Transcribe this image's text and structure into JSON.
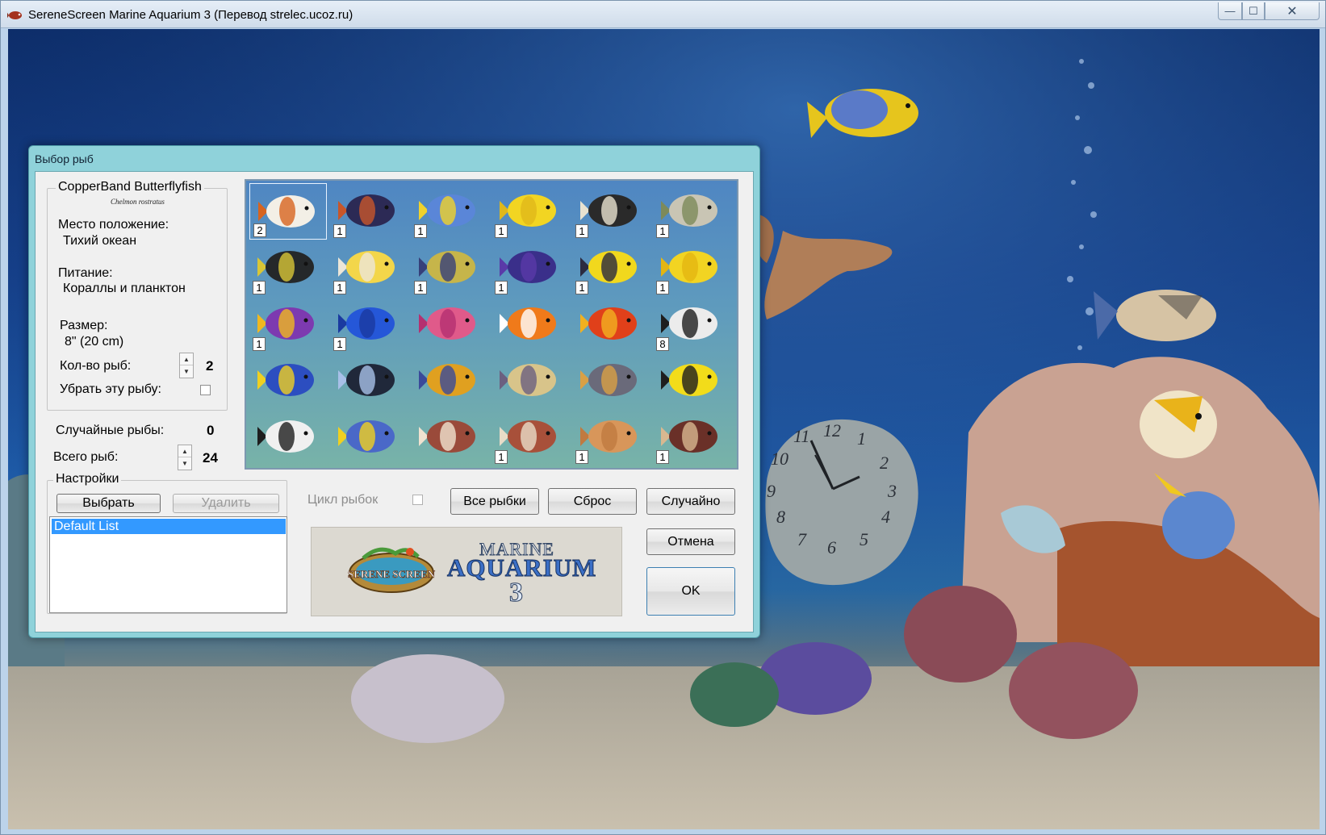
{
  "window": {
    "title": "SereneScreen Marine Aquarium 3 (Перевод strelec.ucoz.ru)",
    "controls": {
      "minimize": "—",
      "maximize": "☐",
      "close": "✕"
    }
  },
  "dialog": {
    "title": "Выбор рыб",
    "fish_info": {
      "name": "CopperBand Butterflyfish",
      "latin": "Chelmon rostratus",
      "location_label": "Место положение:",
      "location_value": "Тихий океан",
      "food_label": "Питание:",
      "food_value": "Кораллы и планктон",
      "size_label": "Размер:",
      "size_value": "8\" (20 cm)",
      "count_label": "Кол-во рыб:",
      "count_value": "2",
      "remove_label": "Убрать эту рыбу:",
      "remove_checked": false
    },
    "random_fish_label": "Случайные рыбы:",
    "random_fish_value": "0",
    "total_fish_label": "Всего рыб:",
    "total_fish_value": "24",
    "settings": {
      "legend": "Настройки",
      "select_button": "Выбрать",
      "delete_button": "Удалить",
      "list_items": [
        "Default List"
      ]
    },
    "cycle_label": "Цикл рыбок",
    "cycle_checked": false,
    "buttons": {
      "all_fish": "Все рыбки",
      "reset": "Сброс",
      "random": "Случайно",
      "cancel": "Отмена",
      "ok": "OK"
    },
    "logo": {
      "badge": "SERENE SCREEN",
      "marine": "MARINE",
      "aquarium": "AQUARIUM",
      "number": "3"
    },
    "fish_grid": [
      {
        "count": "2",
        "colors": [
          "#f3efe6",
          "#d7641f"
        ],
        "selected": true
      },
      {
        "count": "1",
        "colors": [
          "#2c2a55",
          "#c8562a"
        ]
      },
      {
        "count": "1",
        "colors": [
          "#5a86d8",
          "#f0d22b"
        ]
      },
      {
        "count": "1",
        "colors": [
          "#f2d522",
          "#e0b81a"
        ]
      },
      {
        "count": "1",
        "colors": [
          "#2a2a2a",
          "#e8e2d0"
        ]
      },
      {
        "count": "1",
        "colors": [
          "#c9c5b4",
          "#7d8a5a"
        ]
      },
      {
        "count": "1",
        "colors": [
          "#25282a",
          "#d8c637"
        ]
      },
      {
        "count": "1",
        "colors": [
          "#f3d64a",
          "#ece6d8"
        ]
      },
      {
        "count": "1",
        "colors": [
          "#c6b54a",
          "#36407a"
        ]
      },
      {
        "count": "1",
        "colors": [
          "#3a2f8a",
          "#5a3aa8"
        ]
      },
      {
        "count": "1",
        "colors": [
          "#f1d81d",
          "#2b2b40"
        ]
      },
      {
        "count": "1",
        "colors": [
          "#f2d422",
          "#e3b512"
        ]
      },
      {
        "count": "1",
        "colors": [
          "#7d3ab0",
          "#f0b820"
        ]
      },
      {
        "count": "1",
        "colors": [
          "#2557d8",
          "#1a3aa0"
        ]
      },
      {
        "count": "",
        "colors": [
          "#e05a8a",
          "#b43070"
        ]
      },
      {
        "count": "",
        "colors": [
          "#f07a1a",
          "#ffffff"
        ]
      },
      {
        "count": "",
        "colors": [
          "#e0401a",
          "#f2b020"
        ]
      },
      {
        "count": "8",
        "colors": [
          "#ececec",
          "#1e1e1e"
        ]
      },
      {
        "count": "",
        "colors": [
          "#2c4ec0",
          "#f0d020"
        ]
      },
      {
        "count": "",
        "colors": [
          "#20283a",
          "#a8c0e8"
        ]
      },
      {
        "count": "",
        "colors": [
          "#e0a020",
          "#3a4a9a"
        ]
      },
      {
        "count": "",
        "colors": [
          "#d8c48a",
          "#6b6080"
        ]
      },
      {
        "count": "",
        "colors": [
          "#6a6a7a",
          "#d9a045"
        ]
      },
      {
        "count": "",
        "colors": [
          "#f2dc1a",
          "#1e1e1e"
        ]
      },
      {
        "count": "",
        "colors": [
          "#f0f0f0",
          "#1e1e1e"
        ]
      },
      {
        "count": "",
        "colors": [
          "#4a68c8",
          "#f0d020"
        ]
      },
      {
        "count": "",
        "colors": [
          "#9a4a3a",
          "#f0e2d0"
        ]
      },
      {
        "count": "1",
        "colors": [
          "#a8503a",
          "#e8dcc8"
        ]
      },
      {
        "count": "1",
        "colors": [
          "#d8965a",
          "#c07a40"
        ]
      },
      {
        "count": "1",
        "colors": [
          "#6a3028",
          "#d8b890"
        ]
      }
    ]
  },
  "scene": {
    "clock_numbers": [
      "12",
      "1",
      "2",
      "3",
      "4",
      "5",
      "6",
      "7",
      "8",
      "9",
      "10",
      "11"
    ]
  }
}
